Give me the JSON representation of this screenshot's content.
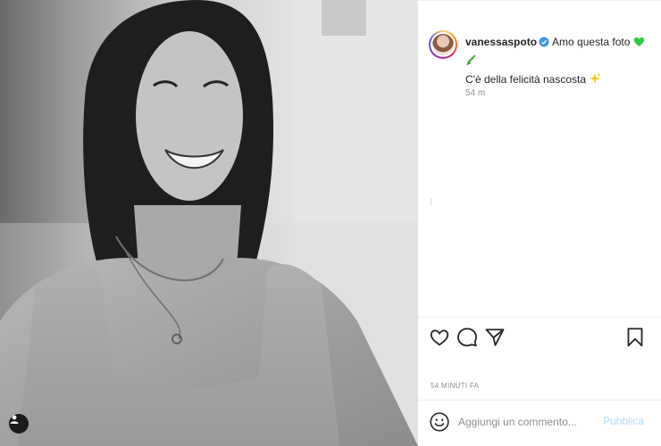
{
  "post": {
    "username": "vanessaspoto",
    "caption_line1": "Amo questa foto",
    "caption_line2": "C'è della felicità nascosta",
    "time_short": "54 m",
    "time_long": "54 MINUTI FA"
  },
  "comment": {
    "placeholder": "Aggiungi un commento...",
    "publish_label": "Pubblica"
  },
  "icons": {
    "heart": "heart-icon",
    "comment": "comment-icon",
    "share": "share-icon",
    "save": "bookmark-icon",
    "emoji": "emoji-icon",
    "verified": "verified-badge-icon",
    "tag": "user-tag-icon"
  },
  "colors": {
    "verified": "#3897f0",
    "publish_disabled": "#b3dbff",
    "green_heart": "#2ecc40"
  }
}
